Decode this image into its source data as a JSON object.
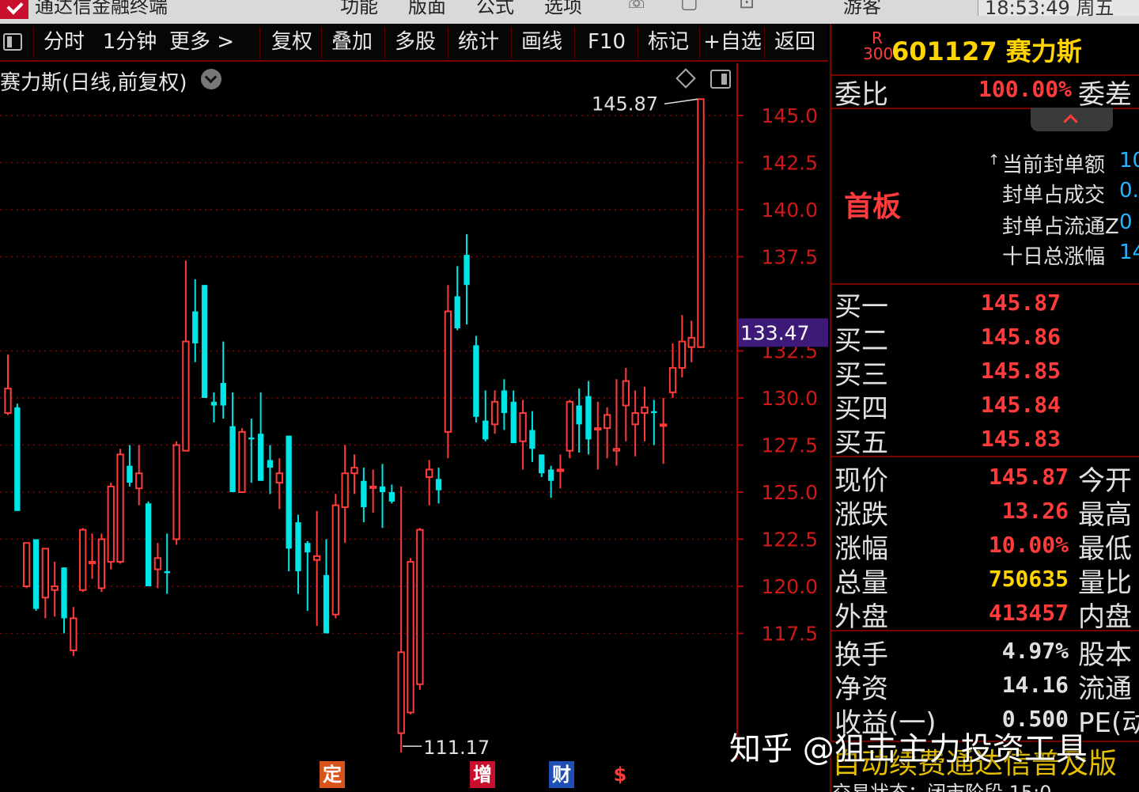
{
  "titlebar": {
    "app_name": "通达信金融终端",
    "menu": [
      "功能",
      "版面",
      "公式",
      "选项"
    ],
    "user": "游客",
    "clock": "18:53:49 周五"
  },
  "toolbar": {
    "items": [
      "分时",
      "1分钟",
      "更多 >",
      "复权",
      "叠加",
      "多股",
      "统计",
      "画线",
      "F10",
      "标记",
      "+自选",
      "返回"
    ]
  },
  "chart": {
    "title": "赛力斯(日线,前复权)",
    "current_price_tag": "133.47",
    "high_label": "145.87",
    "low_label": "111.17",
    "markers": [
      "定",
      "增",
      "财",
      "$"
    ]
  },
  "chart_data": {
    "type": "candlestick",
    "ylim": [
      111.17,
      147.5
    ],
    "yticks": [
      117.5,
      120.0,
      122.5,
      125.0,
      127.5,
      130.0,
      132.5,
      137.5,
      140.0,
      142.5,
      145.0
    ],
    "yticklabels": [
      "117.5",
      "120.0",
      "122.5",
      "125.0",
      "127.5",
      "130.0",
      "132.5",
      "137.5",
      "140.0",
      "142.5",
      "145.0"
    ],
    "up_color": "#ff3b3b",
    "down_color": "#00e5e5",
    "candles": [
      {
        "o": 129.2,
        "h": 132.3,
        "l": 129.1,
        "c": 130.5
      },
      {
        "o": 129.5,
        "h": 129.7,
        "l": 124.0,
        "c": 124.0
      },
      {
        "o": 120.0,
        "h": 122.3,
        "l": 119.9,
        "c": 122.3
      },
      {
        "o": 122.5,
        "h": 122.5,
        "l": 118.7,
        "c": 118.8
      },
      {
        "o": 119.4,
        "h": 121.8,
        "l": 118.3,
        "c": 122.0
      },
      {
        "o": 119.8,
        "h": 121.3,
        "l": 118.4,
        "c": 120.0
      },
      {
        "o": 121.0,
        "h": 121.0,
        "l": 117.5,
        "c": 118.3
      },
      {
        "o": 116.6,
        "h": 118.9,
        "l": 116.3,
        "c": 118.3
      },
      {
        "o": 119.8,
        "h": 123.1,
        "l": 119.7,
        "c": 123.0
      },
      {
        "o": 121.3,
        "h": 122.8,
        "l": 120.4,
        "c": 121.3
      },
      {
        "o": 119.9,
        "h": 122.8,
        "l": 119.7,
        "c": 122.5
      },
      {
        "o": 121.3,
        "h": 125.5,
        "l": 120.9,
        "c": 125.3
      },
      {
        "o": 121.3,
        "h": 127.3,
        "l": 121.2,
        "c": 127.0
      },
      {
        "o": 126.4,
        "h": 127.5,
        "l": 125.3,
        "c": 125.5
      },
      {
        "o": 125.2,
        "h": 127.5,
        "l": 124.3,
        "c": 126.0
      },
      {
        "o": 124.4,
        "h": 124.5,
        "l": 120.0,
        "c": 120.0
      },
      {
        "o": 120.9,
        "h": 122.3,
        "l": 119.9,
        "c": 121.5
      },
      {
        "o": 120.8,
        "h": 122.8,
        "l": 119.6,
        "c": 120.7
      },
      {
        "o": 122.5,
        "h": 127.7,
        "l": 122.2,
        "c": 127.5
      },
      {
        "o": 127.2,
        "h": 137.3,
        "l": 127.2,
        "c": 133.0
      },
      {
        "o": 134.6,
        "h": 136.3,
        "l": 131.9,
        "c": 132.9
      },
      {
        "o": 136.0,
        "h": 136.0,
        "l": 131.6,
        "c": 130.0
      },
      {
        "o": 129.8,
        "h": 130.3,
        "l": 128.7,
        "c": 129.6
      },
      {
        "o": 130.8,
        "h": 133.0,
        "l": 128.9,
        "c": 129.6
      },
      {
        "o": 128.5,
        "h": 130.3,
        "l": 126.1,
        "c": 125.0
      },
      {
        "o": 125.0,
        "h": 128.4,
        "l": 125.1,
        "c": 128.2
      },
      {
        "o": 127.9,
        "h": 128.9,
        "l": 125.5,
        "c": 127.8
      },
      {
        "o": 128.1,
        "h": 130.3,
        "l": 125.6,
        "c": 125.6
      },
      {
        "o": 126.7,
        "h": 127.5,
        "l": 124.9,
        "c": 126.3
      },
      {
        "o": 125.5,
        "h": 126.8,
        "l": 124.1,
        "c": 126.0
      },
      {
        "o": 128.0,
        "h": 128.0,
        "l": 120.8,
        "c": 122.0
      },
      {
        "o": 123.4,
        "h": 123.8,
        "l": 119.6,
        "c": 120.8
      },
      {
        "o": 122.3,
        "h": 122.4,
        "l": 118.7,
        "c": 121.8
      },
      {
        "o": 121.4,
        "h": 124.0,
        "l": 117.9,
        "c": 121.6
      },
      {
        "o": 120.6,
        "h": 122.5,
        "l": 117.9,
        "c": 117.5
      },
      {
        "o": 118.5,
        "h": 124.9,
        "l": 118.3,
        "c": 124.3
      },
      {
        "o": 124.2,
        "h": 127.5,
        "l": 122.3,
        "c": 126.0
      },
      {
        "o": 126.0,
        "h": 127.0,
        "l": 124.9,
        "c": 126.3
      },
      {
        "o": 125.6,
        "h": 126.3,
        "l": 123.4,
        "c": 124.2
      },
      {
        "o": 125.3,
        "h": 126.2,
        "l": 123.9,
        "c": 125.3
      },
      {
        "o": 125.3,
        "h": 126.5,
        "l": 123.1,
        "c": 125.0
      },
      {
        "o": 125.0,
        "h": 125.4,
        "l": 124.4,
        "c": 124.5
      },
      {
        "o": 112.2,
        "h": 125.3,
        "l": 111.17,
        "c": 116.5
      },
      {
        "o": 113.3,
        "h": 121.5,
        "l": 113.2,
        "c": 121.3
      },
      {
        "o": 114.8,
        "h": 123.1,
        "l": 114.5,
        "c": 123.0
      },
      {
        "o": 125.8,
        "h": 126.7,
        "l": 124.3,
        "c": 126.2
      },
      {
        "o": 125.7,
        "h": 126.3,
        "l": 124.4,
        "c": 125.1
      },
      {
        "o": 128.2,
        "h": 136.0,
        "l": 126.8,
        "c": 134.6
      },
      {
        "o": 135.4,
        "h": 137.0,
        "l": 133.6,
        "c": 133.7
      },
      {
        "o": 137.6,
        "h": 138.7,
        "l": 133.9,
        "c": 136.0
      },
      {
        "o": 132.8,
        "h": 133.3,
        "l": 128.7,
        "c": 129.0
      },
      {
        "o": 128.8,
        "h": 130.4,
        "l": 127.7,
        "c": 127.8
      },
      {
        "o": 128.6,
        "h": 130.4,
        "l": 128.1,
        "c": 129.8
      },
      {
        "o": 130.4,
        "h": 131.0,
        "l": 128.3,
        "c": 129.2
      },
      {
        "o": 129.8,
        "h": 130.4,
        "l": 127.7,
        "c": 127.6
      },
      {
        "o": 127.7,
        "h": 129.9,
        "l": 126.2,
        "c": 129.2
      },
      {
        "o": 128.3,
        "h": 129.3,
        "l": 126.6,
        "c": 127.3
      },
      {
        "o": 127.0,
        "h": 127.0,
        "l": 125.8,
        "c": 126.0
      },
      {
        "o": 126.2,
        "h": 126.4,
        "l": 124.7,
        "c": 125.6
      },
      {
        "o": 126.2,
        "h": 127.0,
        "l": 125.2,
        "c": 126.2
      },
      {
        "o": 127.2,
        "h": 129.9,
        "l": 126.8,
        "c": 129.8
      },
      {
        "o": 129.6,
        "h": 130.5,
        "l": 127.1,
        "c": 128.6
      },
      {
        "o": 130.1,
        "h": 130.9,
        "l": 127.0,
        "c": 127.8
      },
      {
        "o": 128.4,
        "h": 129.8,
        "l": 126.2,
        "c": 128.4
      },
      {
        "o": 128.4,
        "h": 129.5,
        "l": 126.8,
        "c": 129.1
      },
      {
        "o": 127.2,
        "h": 131.0,
        "l": 126.4,
        "c": 127.3
      },
      {
        "o": 129.6,
        "h": 131.6,
        "l": 127.7,
        "c": 130.9
      },
      {
        "o": 128.6,
        "h": 130.4,
        "l": 126.9,
        "c": 129.2
      },
      {
        "o": 129.2,
        "h": 130.6,
        "l": 127.7,
        "c": 129.5
      },
      {
        "o": 129.3,
        "h": 129.9,
        "l": 127.5,
        "c": 129.2
      },
      {
        "o": 128.6,
        "h": 130.0,
        "l": 126.5,
        "c": 128.6
      },
      {
        "o": 130.3,
        "h": 132.9,
        "l": 130.0,
        "c": 131.6
      },
      {
        "o": 131.6,
        "h": 134.4,
        "l": 131.1,
        "c": 133.0
      },
      {
        "o": 132.7,
        "h": 134.1,
        "l": 131.9,
        "c": 133.2
      },
      {
        "o": 132.7,
        "h": 145.87,
        "l": 132.7,
        "c": 145.87
      }
    ]
  },
  "quote": {
    "stock_tag_top": "R",
    "stock_tag_bottom": "300",
    "stock_code_name": "601127 赛力斯",
    "weibi_label": "委比",
    "weibi_value": "100.00%",
    "weicha_label": "委差",
    "board_status": "首板",
    "seal_items": [
      {
        "label": "当前封单额",
        "value": "10"
      },
      {
        "label": "封单占成交",
        "value": "0."
      },
      {
        "label": "封单占流通Z",
        "value": "0"
      },
      {
        "label": "十日总涨幅",
        "value": "14"
      }
    ],
    "bids": [
      {
        "label": "买一",
        "price": "145.87"
      },
      {
        "label": "买二",
        "price": "145.86"
      },
      {
        "label": "买三",
        "price": "145.85"
      },
      {
        "label": "买四",
        "price": "145.84"
      },
      {
        "label": "买五",
        "price": "145.83"
      }
    ],
    "stats": [
      {
        "label": "现价",
        "value": "145.87",
        "right": "今开",
        "color": "#ff3b3b"
      },
      {
        "label": "涨跌",
        "value": "13.26",
        "right": "最高",
        "color": "#ff3b3b"
      },
      {
        "label": "涨幅",
        "value": "10.00%",
        "right": "最低",
        "color": "#ff3b3b"
      },
      {
        "label": "总量",
        "value": "750635",
        "right": "量比",
        "color": "#ffd400"
      },
      {
        "label": "外盘",
        "value": "413457",
        "right": "内盘",
        "color": "#ff3b3b"
      }
    ],
    "stats2": [
      {
        "label": "换手",
        "value": "4.97%",
        "right": "股本"
      },
      {
        "label": "净资",
        "value": "14.16",
        "right": "流通"
      },
      {
        "label": "收益(一)",
        "value": "0.500",
        "right": "PE(动"
      }
    ],
    "ticker": "自动续费通达信普及版",
    "bottom_status": "交易状态：闭市阶段 15:0"
  },
  "watermark": "知乎 @狙击主力投资工具"
}
